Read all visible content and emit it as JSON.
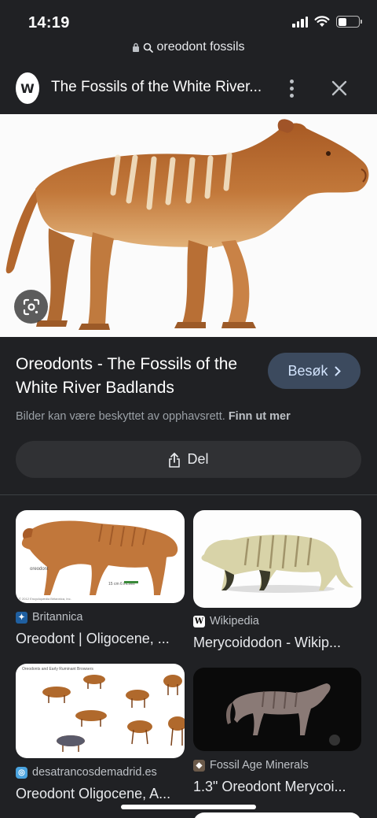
{
  "status_bar": {
    "time": "14:19",
    "battery_percent": 40
  },
  "url_bar": {
    "text": "oreodont fossils"
  },
  "header": {
    "logo_letter": "W",
    "title": "The Fossils of the White River..."
  },
  "result": {
    "title": "Oreodonts - The Fossils of the White River Badlands",
    "visit_label": "Besøk",
    "copyright_text": "Bilder kan være beskyttet av opphavsrett.",
    "copyright_link": "Finn ut mer",
    "share_label": "Del"
  },
  "related": [
    {
      "source": "Britannica",
      "caption": "Oreodont | Oligocene, ...",
      "thumb_text": "oreodont",
      "scale_text": "15 cm 6 inches",
      "credit": "© 2012 Encyclopædia Britannica, Inc."
    },
    {
      "source": "Wikipedia",
      "caption": "Merycoidodon - Wikip..."
    },
    {
      "source": "desatrancosdemadrid.es",
      "caption": "Oreodont Oligocene, A...",
      "thumb_heading": "Oreodonts and Early Ruminant Browsers"
    },
    {
      "source": "Fossil Age Minerals",
      "caption": "1.3\" Oreodont Merycoi..."
    }
  ],
  "colors": {
    "background": "#202124",
    "visit_button": "#3c4a5e",
    "visit_text": "#d2e3fc",
    "share_button": "#303134"
  },
  "icons": [
    "lock-icon",
    "search-icon",
    "more-vert-icon",
    "close-icon",
    "google-lens-icon",
    "chevron-right-icon",
    "share-icon"
  ]
}
